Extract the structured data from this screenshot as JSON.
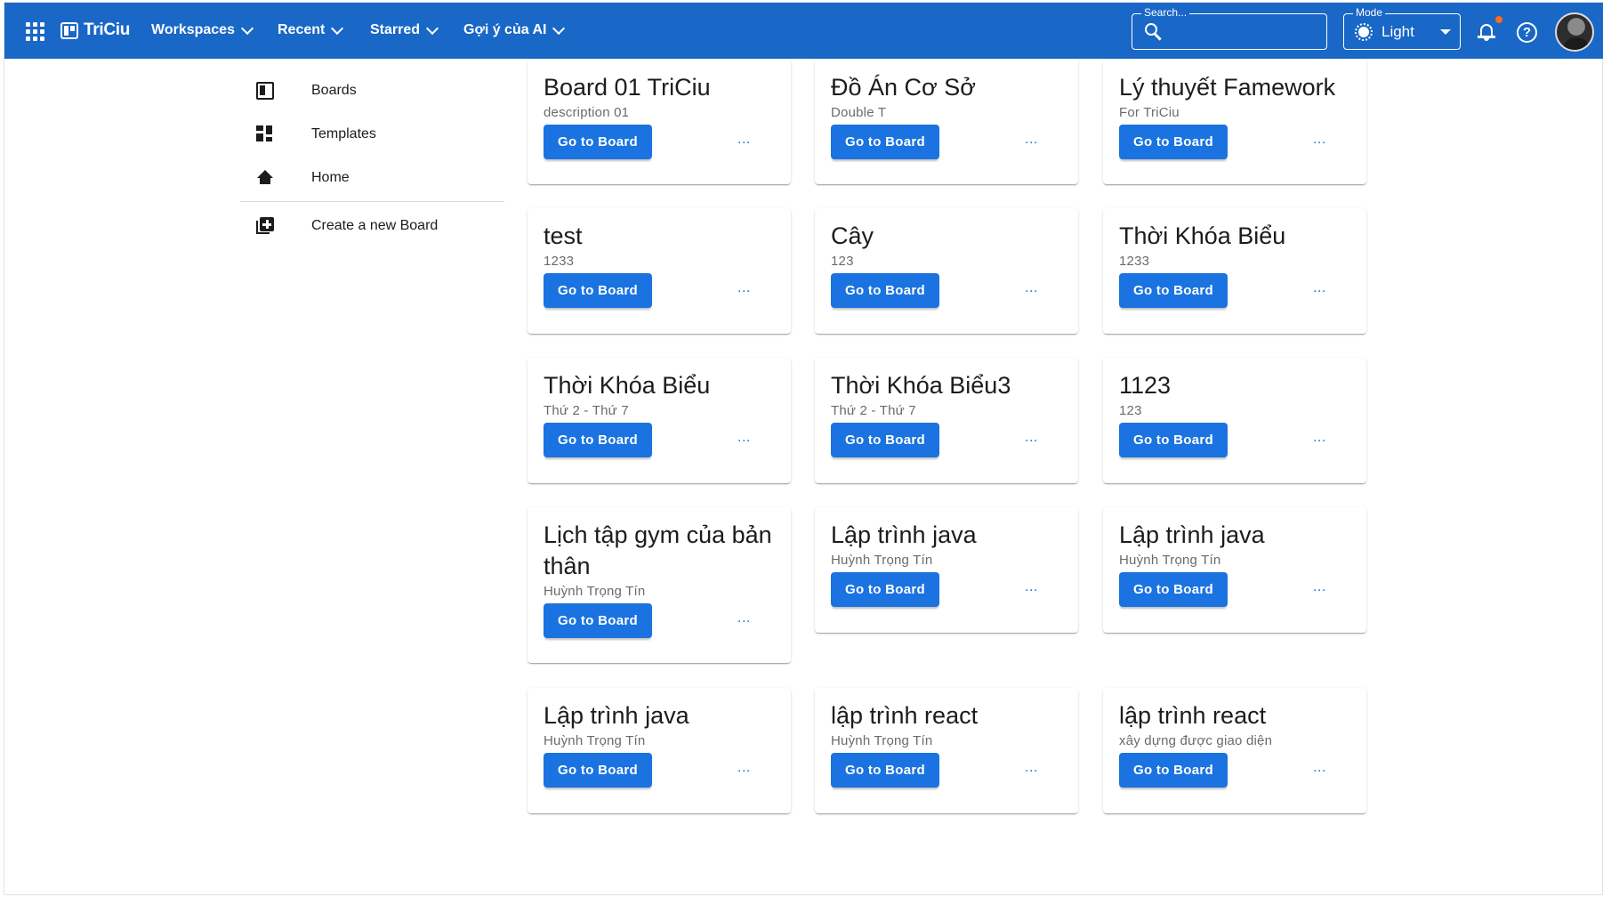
{
  "appbar": {
    "brand": "TriCiu",
    "menus": [
      {
        "label": "Workspaces"
      },
      {
        "label": "Recent"
      },
      {
        "label": "Starred"
      },
      {
        "label": "Gợi ý của AI"
      }
    ],
    "search": {
      "label": "Search...",
      "value": ""
    },
    "mode": {
      "label": "Mode",
      "value": "Light"
    },
    "notification_dot_color": "#ff6a1f",
    "help_glyph": "?",
    "bar_color": "#1967c6"
  },
  "sidebar": {
    "items": [
      {
        "label": "Boards",
        "icon": "boards-icon"
      },
      {
        "label": "Templates",
        "icon": "templates-icon"
      },
      {
        "label": "Home",
        "icon": "home-icon"
      }
    ],
    "create": {
      "label": "Create a new Board",
      "icon": "add-board-icon"
    }
  },
  "boards": [
    {
      "title": "Board 01 TriCiu",
      "description": "description 01",
      "button": "Go to Board",
      "more": "..."
    },
    {
      "title": "Đồ Án Cơ Sở",
      "description": "Double T",
      "button": "Go to Board",
      "more": "..."
    },
    {
      "title": "Lý thuyết Famework",
      "description": "For TriCiu",
      "button": "Go to Board",
      "more": "..."
    },
    {
      "title": "test",
      "description": "1233",
      "button": "Go to Board",
      "more": "..."
    },
    {
      "title": "Cây",
      "description": "123",
      "button": "Go to Board",
      "more": "..."
    },
    {
      "title": "Thời Khóa Biểu",
      "description": "1233",
      "button": "Go to Board",
      "more": "..."
    },
    {
      "title": "Thời Khóa Biểu",
      "description": "Thứ 2 - Thứ 7",
      "button": "Go to Board",
      "more": "..."
    },
    {
      "title": "Thời Khóa Biểu3",
      "description": "Thứ 2 - Thứ 7",
      "button": "Go to Board",
      "more": "..."
    },
    {
      "title": "1123",
      "description": "123",
      "button": "Go to Board",
      "more": "..."
    },
    {
      "title": "Lịch tập gym của bản thân",
      "description": "Huỳnh Trọng Tín",
      "button": "Go to Board",
      "more": "..."
    },
    {
      "title": "Lập trình java",
      "description": "Huỳnh Trọng Tín",
      "button": "Go to Board",
      "more": "..."
    },
    {
      "title": "Lập trình java",
      "description": "Huỳnh Trọng Tín",
      "button": "Go to Board",
      "more": "..."
    },
    {
      "title": "Lập trình java",
      "description": "Huỳnh Trọng Tín",
      "button": "Go to Board",
      "more": "..."
    },
    {
      "title": "lập trình react",
      "description": "Huỳnh Trọng Tín",
      "button": "Go to Board",
      "more": "..."
    },
    {
      "title": "lập trình react",
      "description": "xây dựng được giao diện",
      "button": "Go to Board",
      "more": "..."
    }
  ]
}
